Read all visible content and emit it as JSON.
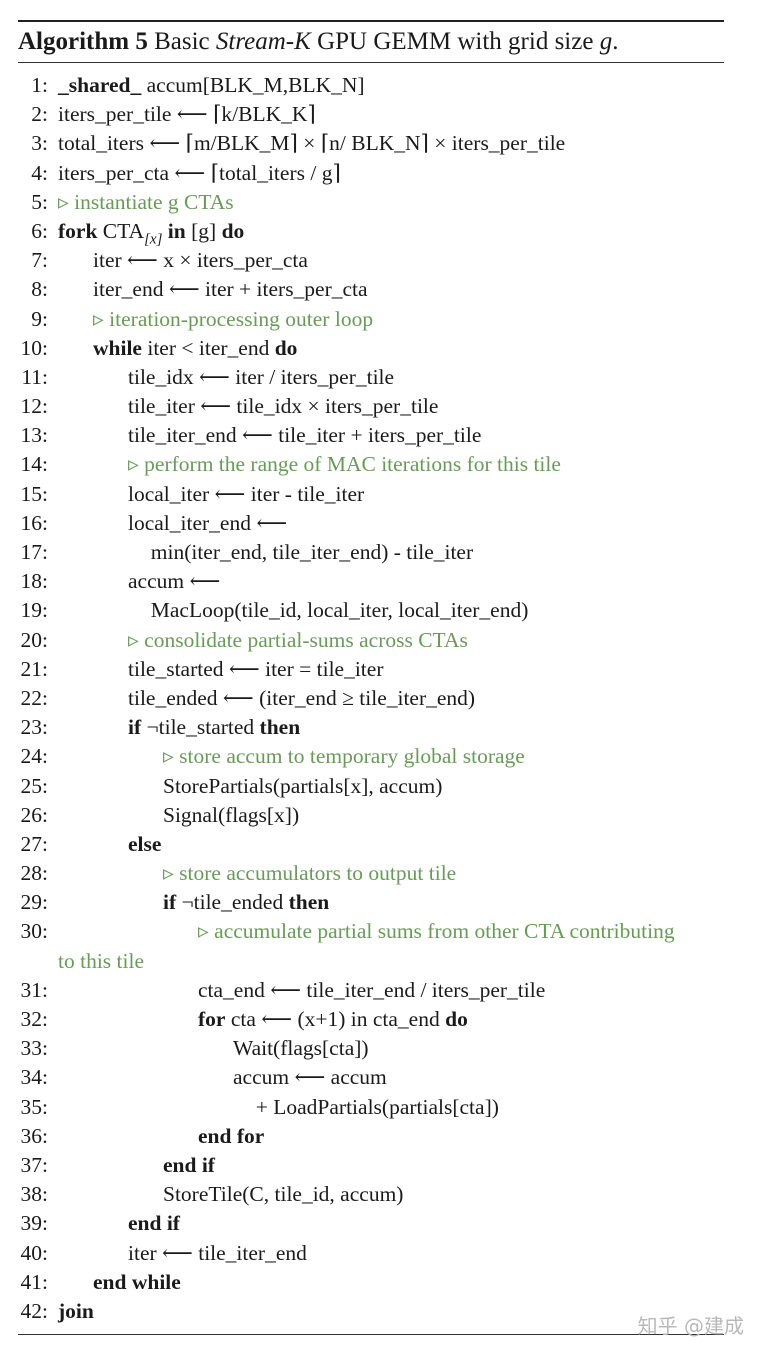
{
  "caption": {
    "label": "Algorithm 5",
    "text_before": "Basic",
    "text_em": "Stream-K",
    "text_after": "GPU GEMM with grid size",
    "text_var": "g",
    "text_end": "."
  },
  "lines": [
    {
      "n": "1:",
      "indent": 0,
      "parts": [
        {
          "t": "_shared_",
          "s": "kw"
        },
        {
          "t": " accum[BLK_M,BLK_N]"
        }
      ]
    },
    {
      "n": "2:",
      "indent": 0,
      "parts": [
        {
          "t": "iters_per_tile ⟵ ⌈k/BLK_K⌉"
        }
      ]
    },
    {
      "n": "3:",
      "indent": 0,
      "parts": [
        {
          "t": "total_iters ⟵ ⌈m/BLK_M⌉ × ⌈n/ BLK_N⌉ × iters_per_tile"
        }
      ]
    },
    {
      "n": "4:",
      "indent": 0,
      "parts": [
        {
          "t": "iters_per_cta ⟵ ⌈total_iters / g⌉"
        }
      ]
    },
    {
      "n": "5:",
      "indent": 0,
      "parts": [
        {
          "t": "▹ instantiate g CTAs",
          "s": "comment"
        }
      ]
    },
    {
      "n": "6:",
      "indent": 0,
      "parts": [
        {
          "t": "fork",
          "s": "kw"
        },
        {
          "t": " CTA"
        },
        {
          "t": "[x]",
          "s": "sub"
        },
        {
          "t": " "
        },
        {
          "t": "in",
          "s": "kw"
        },
        {
          "t": " [g] "
        },
        {
          "t": "do",
          "s": "kw"
        }
      ]
    },
    {
      "n": "7:",
      "indent": 1,
      "parts": [
        {
          "t": "iter ⟵ x × iters_per_cta"
        }
      ]
    },
    {
      "n": "8:",
      "indent": 1,
      "parts": [
        {
          "t": "iter_end ⟵ iter + iters_per_cta"
        }
      ]
    },
    {
      "n": "9:",
      "indent": 1,
      "parts": [
        {
          "t": "▹ iteration-processing outer loop",
          "s": "comment"
        }
      ]
    },
    {
      "n": "10:",
      "indent": 1,
      "parts": [
        {
          "t": "while",
          "s": "kw"
        },
        {
          "t": " iter < iter_end "
        },
        {
          "t": "do",
          "s": "kw"
        }
      ]
    },
    {
      "n": "11:",
      "indent": 2,
      "parts": [
        {
          "t": "tile_idx ⟵ iter / iters_per_tile"
        }
      ]
    },
    {
      "n": "12:",
      "indent": 2,
      "parts": [
        {
          "t": "tile_iter ⟵ tile_idx × iters_per_tile"
        }
      ]
    },
    {
      "n": "13:",
      "indent": 2,
      "parts": [
        {
          "t": "tile_iter_end ⟵ tile_iter + iters_per_tile"
        }
      ]
    },
    {
      "n": "14:",
      "indent": 2,
      "parts": [
        {
          "t": "▹ perform the range of MAC iterations for this tile",
          "s": "comment"
        }
      ]
    },
    {
      "n": "15:",
      "indent": 2,
      "parts": [
        {
          "t": "local_iter ⟵ iter - tile_iter"
        }
      ]
    },
    {
      "n": "16:",
      "indent": 2,
      "parts": [
        {
          "t": "local_iter_end ⟵"
        }
      ]
    },
    {
      "n": "17:",
      "indent": 2.65,
      "parts": [
        {
          "t": "min(iter_end, tile_iter_end) - tile_iter"
        }
      ]
    },
    {
      "n": "18:",
      "indent": 2,
      "parts": [
        {
          "t": "accum ⟵"
        }
      ]
    },
    {
      "n": "19:",
      "indent": 2.65,
      "parts": [
        {
          "t": "MacLoop(tile_id, local_iter, local_iter_end)"
        }
      ]
    },
    {
      "n": "20:",
      "indent": 2,
      "parts": [
        {
          "t": "▹ consolidate partial-sums across CTAs",
          "s": "comment"
        }
      ]
    },
    {
      "n": "21:",
      "indent": 2,
      "parts": [
        {
          "t": "tile_started ⟵ iter = tile_iter"
        }
      ]
    },
    {
      "n": "22:",
      "indent": 2,
      "parts": [
        {
          "t": "tile_ended ⟵ (iter_end ≥ tile_iter_end)"
        }
      ]
    },
    {
      "n": "23:",
      "indent": 2,
      "parts": [
        {
          "t": "if",
          "s": "kw"
        },
        {
          "t": " ¬tile_started "
        },
        {
          "t": "then",
          "s": "kw"
        }
      ]
    },
    {
      "n": "24:",
      "indent": 3,
      "parts": [
        {
          "t": "▹ store accum to temporary global storage",
          "s": "comment"
        }
      ]
    },
    {
      "n": "25:",
      "indent": 3,
      "parts": [
        {
          "t": "StorePartials(partials[x], accum)"
        }
      ]
    },
    {
      "n": "26:",
      "indent": 3,
      "parts": [
        {
          "t": "Signal(flags[x])"
        }
      ]
    },
    {
      "n": "27:",
      "indent": 2,
      "parts": [
        {
          "t": "else",
          "s": "kw"
        }
      ]
    },
    {
      "n": "28:",
      "indent": 3,
      "parts": [
        {
          "t": "▹ store accumulators to output tile",
          "s": "comment"
        }
      ]
    },
    {
      "n": "29:",
      "indent": 3,
      "parts": [
        {
          "t": "if",
          "s": "kw"
        },
        {
          "t": " ¬tile_ended "
        },
        {
          "t": "then",
          "s": "kw"
        }
      ]
    },
    {
      "n": "30:",
      "indent": 4,
      "parts": [
        {
          "t": "▹ accumulate partial sums from other CTA contributing",
          "s": "comment"
        }
      ],
      "continuation": "to this tile"
    },
    {
      "n": "31:",
      "indent": 4,
      "parts": [
        {
          "t": "cta_end ⟵ tile_iter_end / iters_per_tile"
        }
      ]
    },
    {
      "n": "32:",
      "indent": 4,
      "parts": [
        {
          "t": "for",
          "s": "kw"
        },
        {
          "t": " cta ⟵ (x+1) in cta_end "
        },
        {
          "t": "do",
          "s": "kw"
        }
      ]
    },
    {
      "n": "33:",
      "indent": 5,
      "parts": [
        {
          "t": "Wait(flags[cta])"
        }
      ]
    },
    {
      "n": "34:",
      "indent": 5,
      "parts": [
        {
          "t": "accum ⟵ accum"
        }
      ]
    },
    {
      "n": "35:",
      "indent": 5.65,
      "parts": [
        {
          "t": "+ LoadPartials(partials[cta])"
        }
      ]
    },
    {
      "n": "36:",
      "indent": 4,
      "parts": [
        {
          "t": "end for",
          "s": "kw"
        }
      ]
    },
    {
      "n": "37:",
      "indent": 3,
      "parts": [
        {
          "t": "end if",
          "s": "kw"
        }
      ]
    },
    {
      "n": "38:",
      "indent": 3,
      "parts": [
        {
          "t": "StoreTile(C, tile_id, accum)"
        }
      ]
    },
    {
      "n": "39:",
      "indent": 2,
      "parts": [
        {
          "t": "end if",
          "s": "kw"
        }
      ]
    },
    {
      "n": "40:",
      "indent": 2,
      "parts": [
        {
          "t": "iter ⟵ tile_iter_end"
        }
      ]
    },
    {
      "n": "41:",
      "indent": 1,
      "parts": [
        {
          "t": "end while",
          "s": "kw"
        }
      ]
    },
    {
      "n": "42:",
      "indent": 0,
      "parts": [
        {
          "t": "join",
          "s": "kw"
        }
      ]
    }
  ],
  "watermark": "知乎 @建成"
}
